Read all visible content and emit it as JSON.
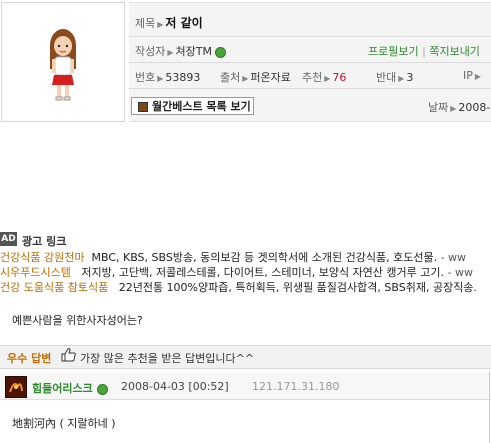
{
  "post": {
    "title_label": "제목",
    "title": "저 같이",
    "author_label": "작성자",
    "author": "쳐장TM",
    "profile_link": "프로필보기",
    "separator": "|",
    "message_link": "쪽지보내기",
    "number_label": "번호",
    "number": "53893",
    "source_label": "출처",
    "source": "퍼온자료",
    "recommend_label": "추천",
    "recommend": "76",
    "oppose_label": "반대",
    "oppose": "3",
    "ip_label": "IP",
    "monthly_best_button": "월간베스트 목록 보기",
    "date_label": "날짜",
    "date": "2008-"
  },
  "ad": {
    "tag": "AD",
    "title": "광고 링크",
    "items": [
      {
        "name": "건강식품 강원천마",
        "desc": "MBC, KBS, SBS방송, 동의보감 등 겟의학서에 소개된 건강식품, 호도선물.",
        "link": "- ww"
      },
      {
        "name": "시우푸드시스템",
        "desc": "저지방, 고단백, 저콜레스테롤, 다이어트, 스테미너, 보양식 자연산 캥거루 고기.",
        "link": "- ww"
      },
      {
        "name": "건강 도움식품 참토식품",
        "desc": "22년전통 100%양파즙, 특허획득, 위생필 품질검사합격, SBS취재, 공장직송.",
        "link": ""
      }
    ]
  },
  "question_body": "예쁜사람을 위한사자성어는?",
  "best_answer": {
    "label": "우수 답변",
    "description": "가장 많은 추천을 받은 답변입니다^^"
  },
  "answer": {
    "user": "힘들어리스크",
    "date": "2008-04-03 [00:52]",
    "ip": "121.171.31.180",
    "body": "地割河內 ( 지랄하네 )"
  },
  "colors": {
    "accent_orange": "#c26e00",
    "green": "#2d8b2d",
    "red": "#c8102e"
  },
  "icons": [
    "online-status-icon",
    "thumbs-up-icon",
    "user-avatar-icon"
  ]
}
